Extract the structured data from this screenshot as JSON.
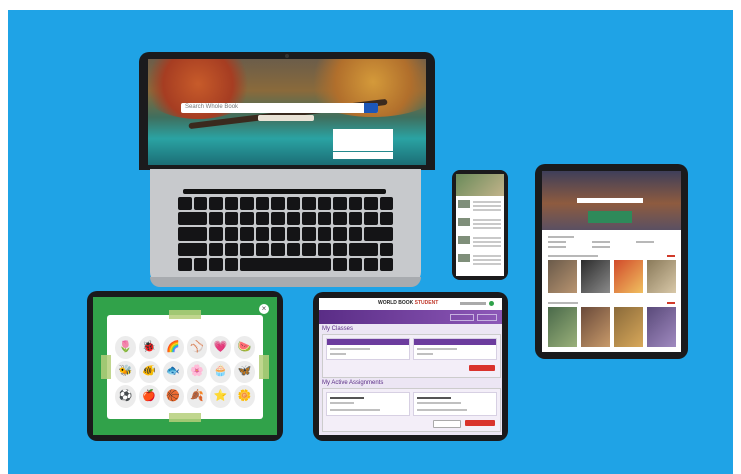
{
  "laptop": {
    "search_placeholder": "Search Whole Book"
  },
  "game": {
    "close_label": "×",
    "icons": [
      "🌷",
      "🐞",
      "🌈",
      "⚾",
      "💗",
      "🍉",
      "🐝",
      "🐠",
      "🐟",
      "🌸",
      "🧁",
      "🦋",
      "⚽",
      "🍎",
      "🏀",
      "🍂",
      "⭐",
      "🌼"
    ]
  },
  "classes_app": {
    "logo_main": "WORLD BOOK",
    "logo_accent": "STUDENT",
    "section_classes": "My Classes",
    "section_assignments": "My Active Assignments"
  },
  "colors": {
    "background": "#1fa3e6",
    "game_green": "#31a24a",
    "app_purple": "#6c3c9e",
    "accent_red": "#d9332c"
  }
}
